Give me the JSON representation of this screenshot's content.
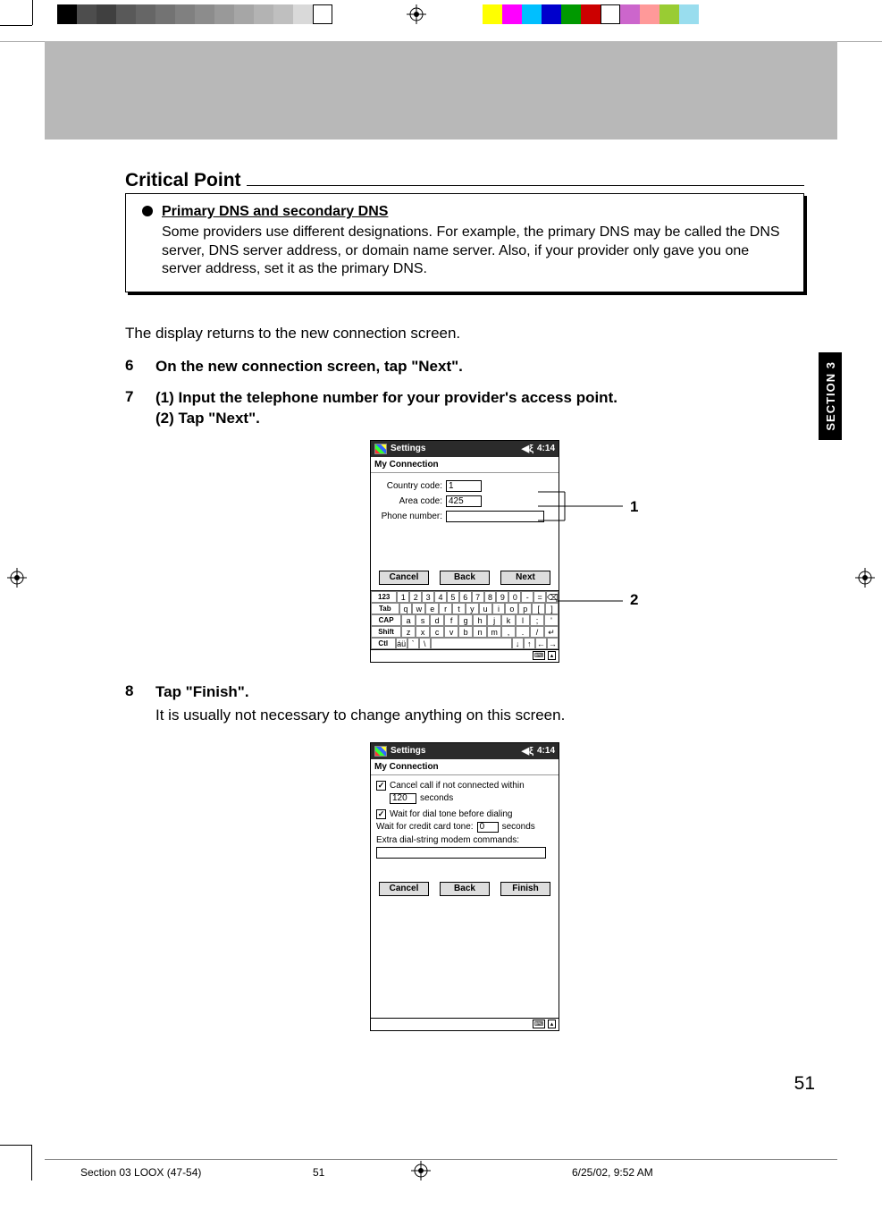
{
  "colorbar": [
    "#000000",
    "#4d4d4d",
    "#404040",
    "#595959",
    "#666666",
    "#737373",
    "#808080",
    "#8c8c8c",
    "#999999",
    "#a6a6a6",
    "#b3b3b3",
    "#bfbfbf",
    "#d9d9d9",
    "#ffffff"
  ],
  "colorbar2": [
    "#ffff00",
    "#ff00ff",
    "#00bfff",
    "#0000cc",
    "#009900",
    "#cc0000",
    "#cc66cc",
    "#ff9999",
    "#99cc33",
    "#99ddee"
  ],
  "section_tab": "SECTION 3",
  "critical_point": {
    "heading": "Critical Point",
    "bullet_title": "Primary DNS and secondary DNS",
    "bullet_body": "Some providers use different designations. For example, the primary DNS may be called the DNS server, DNS server address, or domain name server. Also, if your provider only gave you one server address, set it as the primary DNS."
  },
  "body": {
    "returns": "The display returns to the new connection screen.",
    "step6_num": "6",
    "step6": "On the new connection screen, tap \"Next\".",
    "step7_num": "7",
    "step7_line1": "(1) Input the telephone number for your provider's access point.",
    "step7_line2": "(2) Tap \"Next\".",
    "step8_num": "8",
    "step8_title": "Tap \"Finish\".",
    "step8_body": "It is usually not necessary to change anything on this screen."
  },
  "callouts": {
    "one": "1",
    "two": "2"
  },
  "ppc1": {
    "title": "Settings",
    "time": "4:14",
    "sub": "My Connection",
    "country_label": "Country code:",
    "country_val": "1",
    "area_label": "Area code:",
    "area_val": "425",
    "phone_label": "Phone number:",
    "phone_val": "",
    "btn_cancel": "Cancel",
    "btn_back": "Back",
    "btn_next": "Next"
  },
  "ppc2": {
    "title": "Settings",
    "time": "4:14",
    "sub": "My Connection",
    "cancel_call_label": "Cancel call if not connected within",
    "cancel_call_val": "120",
    "seconds": "seconds",
    "wait_dial": "Wait for dial tone before dialing",
    "wait_credit_pre": "Wait for credit card tone:",
    "wait_credit_val": "0",
    "extra_label": "Extra dial-string modem commands:",
    "btn_cancel": "Cancel",
    "btn_back": "Back",
    "btn_finish": "Finish"
  },
  "kbd": {
    "r1": [
      "123",
      "1",
      "2",
      "3",
      "4",
      "5",
      "6",
      "7",
      "8",
      "9",
      "0",
      "-",
      "=",
      "⌫"
    ],
    "r2": [
      "Tab",
      "q",
      "w",
      "e",
      "r",
      "t",
      "y",
      "u",
      "i",
      "o",
      "p",
      "[",
      "]"
    ],
    "r3": [
      "CAP",
      "a",
      "s",
      "d",
      "f",
      "g",
      "h",
      "j",
      "k",
      "l",
      ";",
      "'"
    ],
    "r4": [
      "Shift",
      "z",
      "x",
      "c",
      "v",
      "b",
      "n",
      "m",
      ",",
      ".",
      "/",
      "↵"
    ],
    "r5": [
      "Ctl",
      "áü",
      "`",
      "\\",
      " ",
      "↓",
      "↑",
      "←",
      "→"
    ]
  },
  "page_number": "51",
  "footer": {
    "doc": "Section 03 LOOX (47-54)",
    "page": "51",
    "date": "6/25/02, 9:52 AM"
  }
}
